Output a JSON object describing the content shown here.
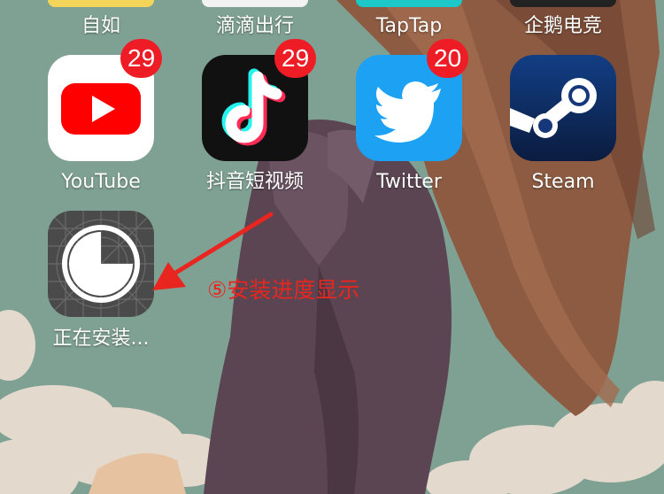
{
  "top_row": [
    {
      "label": "自如"
    },
    {
      "label": "滴滴出行"
    },
    {
      "label": "TapTap"
    },
    {
      "label": "企鹅电竞"
    }
  ],
  "apps": [
    {
      "label": "YouTube",
      "badge": "29",
      "icon": "youtube-icon"
    },
    {
      "label": "抖音短视频",
      "badge": "29",
      "icon": "tiktok-icon"
    },
    {
      "label": "Twitter",
      "badge": "20",
      "icon": "twitter-icon"
    },
    {
      "label": "Steam",
      "badge": "",
      "icon": "steam-icon"
    }
  ],
  "installing": {
    "label": "正在安装...",
    "icon": "install-progress-icon",
    "progress": 0.25
  },
  "annotation": {
    "text": "⑤安装进度显示",
    "color": "#e8261f"
  },
  "colors": {
    "badge": "#ee1c25",
    "youtube_red": "#ff0000",
    "twitter_blue": "#1da1f2",
    "steam_navy": "#0f2a5c",
    "tiktok_bg": "#111111"
  }
}
